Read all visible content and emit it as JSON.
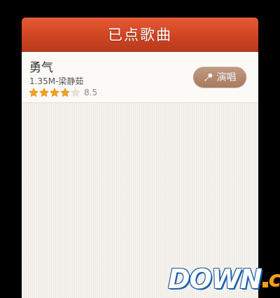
{
  "header": {
    "title": "已点歌曲"
  },
  "songs": [
    {
      "title": "勇气",
      "meta": "1.35M-梁静茹",
      "rating": 4,
      "rating_max": 5,
      "score": "8.5",
      "action_label": "演唱",
      "action_icon": "microphone-icon"
    }
  ],
  "colors": {
    "header": "#d24a26",
    "star_filled": "#f2a31b",
    "star_empty": "#e8e2d8",
    "button": "#b48a70",
    "background": "#f6f3ee"
  },
  "watermark": {
    "main": "DOWN",
    "suffix": "cc"
  }
}
